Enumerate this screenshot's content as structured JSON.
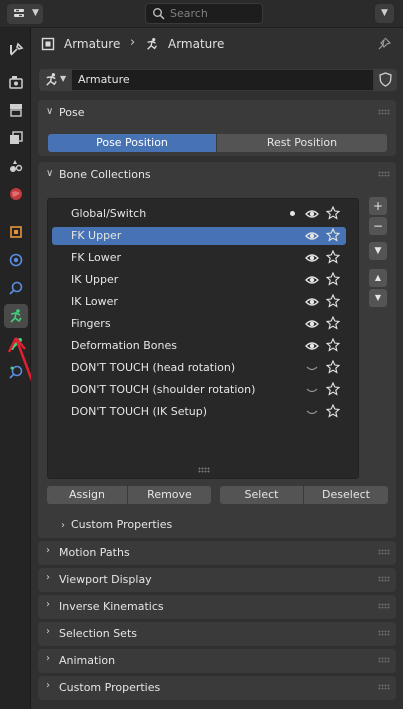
{
  "header": {
    "search_placeholder": "Search"
  },
  "breadcrumb": {
    "object_name": "Armature",
    "data_name": "Armature"
  },
  "datablock": {
    "name": "Armature"
  },
  "pose_panel": {
    "title": "Pose",
    "pose_position": "Pose Position",
    "rest_position": "Rest Position",
    "active": "Pose Position"
  },
  "bone_collections": {
    "title": "Bone Collections",
    "items": [
      {
        "name": "Global/Switch",
        "dot": true,
        "visible": true,
        "selected": false
      },
      {
        "name": "FK Upper",
        "dot": false,
        "visible": true,
        "selected": true
      },
      {
        "name": "FK Lower",
        "dot": false,
        "visible": true,
        "selected": false
      },
      {
        "name": "IK Upper",
        "dot": false,
        "visible": true,
        "selected": false
      },
      {
        "name": "IK Lower",
        "dot": false,
        "visible": true,
        "selected": false
      },
      {
        "name": "Fingers",
        "dot": false,
        "visible": true,
        "selected": false
      },
      {
        "name": "Deformation Bones",
        "dot": false,
        "visible": true,
        "selected": false
      },
      {
        "name": "DON'T TOUCH (head rotation)",
        "dot": false,
        "visible": false,
        "selected": false
      },
      {
        "name": "DON'T TOUCH (shoulder rotation)",
        "dot": false,
        "visible": false,
        "selected": false
      },
      {
        "name": "DON'T TOUCH (IK Setup)",
        "dot": false,
        "visible": false,
        "selected": false
      }
    ],
    "buttons": {
      "assign": "Assign",
      "remove": "Remove",
      "select": "Select",
      "deselect": "Deselect"
    },
    "sub_panel": "Custom Properties"
  },
  "collapsed_panels": [
    "Motion Paths",
    "Viewport Display",
    "Inverse Kinematics",
    "Selection Sets",
    "Animation",
    "Custom Properties"
  ],
  "colors": {
    "accent": "#4772b3",
    "annotation_red": "#e02030",
    "active_tab_icon": "#3fd07a"
  }
}
